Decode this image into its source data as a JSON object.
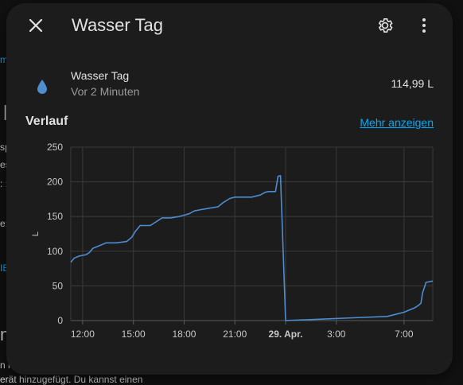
{
  "background": {
    "fragments": [
      "m",
      "|",
      "sp",
      "es",
      ": :",
      "e:",
      "IE",
      "m",
      "n i",
      "erät hinzugefügt. Du kannst einen"
    ]
  },
  "dialog": {
    "title": "Wasser Tag",
    "close_icon": "close-icon",
    "settings_icon": "gear-icon",
    "menu_icon": "dots-vertical-icon"
  },
  "entity": {
    "icon": "water-drop-icon",
    "name": "Wasser Tag",
    "last_changed": "Vor 2 Minuten",
    "state": "114,99 L"
  },
  "history": {
    "title": "Verlauf",
    "more_link": "Mehr anzeigen"
  },
  "colors": {
    "accent": "#03a9f4",
    "line": "#4c8ccf",
    "drop": "#4e8ecf",
    "dialog_bg": "#1c1c1c"
  },
  "chart_data": {
    "type": "line",
    "ylabel": "L",
    "ylim": [
      0,
      250
    ],
    "yticks": [
      0,
      50,
      100,
      150,
      200,
      250
    ],
    "xlim": [
      11.3,
      32.7
    ],
    "xticks": [
      {
        "v": 12,
        "label": "12:00",
        "bold": false
      },
      {
        "v": 15,
        "label": "15:00",
        "bold": false
      },
      {
        "v": 18,
        "label": "18:00",
        "bold": false
      },
      {
        "v": 21,
        "label": "21:00",
        "bold": false
      },
      {
        "v": 24,
        "label": "29. Apr.",
        "bold": true
      },
      {
        "v": 27,
        "label": "3:00",
        "bold": false
      },
      {
        "v": 31,
        "label": "7:00",
        "bold": false
      }
    ],
    "grid": true,
    "series": [
      {
        "x": [
          11.3,
          11.5,
          11.8,
          12.2,
          12.4,
          12.6,
          13.0,
          13.4,
          14.0,
          14.6,
          14.9,
          15.1,
          15.4,
          16.0,
          16.7,
          17.2,
          17.7,
          18.0,
          18.3,
          18.6,
          19.0,
          19.5,
          20.0,
          20.3,
          20.7,
          21.0,
          21.5,
          22.0,
          22.5,
          22.8,
          23.0,
          23.4,
          23.55,
          23.7,
          24.0,
          26.0,
          28.0,
          30.0,
          30.5,
          31.0,
          31.3,
          31.6,
          31.8,
          32.0,
          32.1,
          32.3,
          32.7
        ],
        "y": [
          84,
          90,
          93,
          95,
          98,
          104,
          108,
          112,
          112,
          114,
          120,
          128,
          137,
          137,
          148,
          148,
          150,
          152,
          154,
          158,
          160,
          162,
          164,
          170,
          176,
          178,
          178,
          178,
          181,
          185,
          186,
          186,
          208,
          209,
          0,
          2,
          4,
          6,
          9,
          12,
          15,
          18,
          21,
          25,
          40,
          55,
          57
        ]
      }
    ]
  }
}
